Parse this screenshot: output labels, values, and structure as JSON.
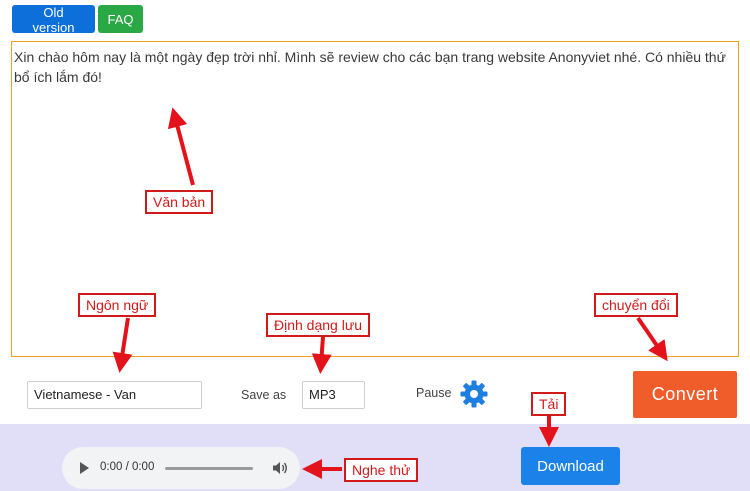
{
  "header": {
    "old_version_label": "Old version",
    "faq_label": "FAQ"
  },
  "editor": {
    "text": "Xin chào hôm nay là một ngày đẹp trời nhỉ. Mình sẽ review cho các bạn trang website Anonyviet nhé. Có nhiều thứ bổ ích lắm đó!"
  },
  "controls": {
    "language_value": "Vietnamese - Van",
    "save_as_label": "Save as",
    "format_value": "MP3",
    "pause_label": "Pause",
    "convert_label": "Convert"
  },
  "player": {
    "time": "0:00 / 0:00"
  },
  "download_label": "Download",
  "annotations": {
    "text": "Văn bản",
    "language": "Ngôn ngữ",
    "format": "Định dạng lưu",
    "convert": "chuyển đổi",
    "download": "Tải",
    "listen": "Nghe thử"
  },
  "colors": {
    "primary": "#0d6fd9",
    "faq": "#2aa845",
    "convert": "#f05c2a",
    "download": "#1a82e9",
    "annotation": "#d31a1a",
    "textarea_border": "#f0a21e",
    "bottom_band": "#e0dff7"
  },
  "icons": {
    "settings": "gear-icon",
    "play": "play-icon",
    "volume": "volume-icon"
  }
}
